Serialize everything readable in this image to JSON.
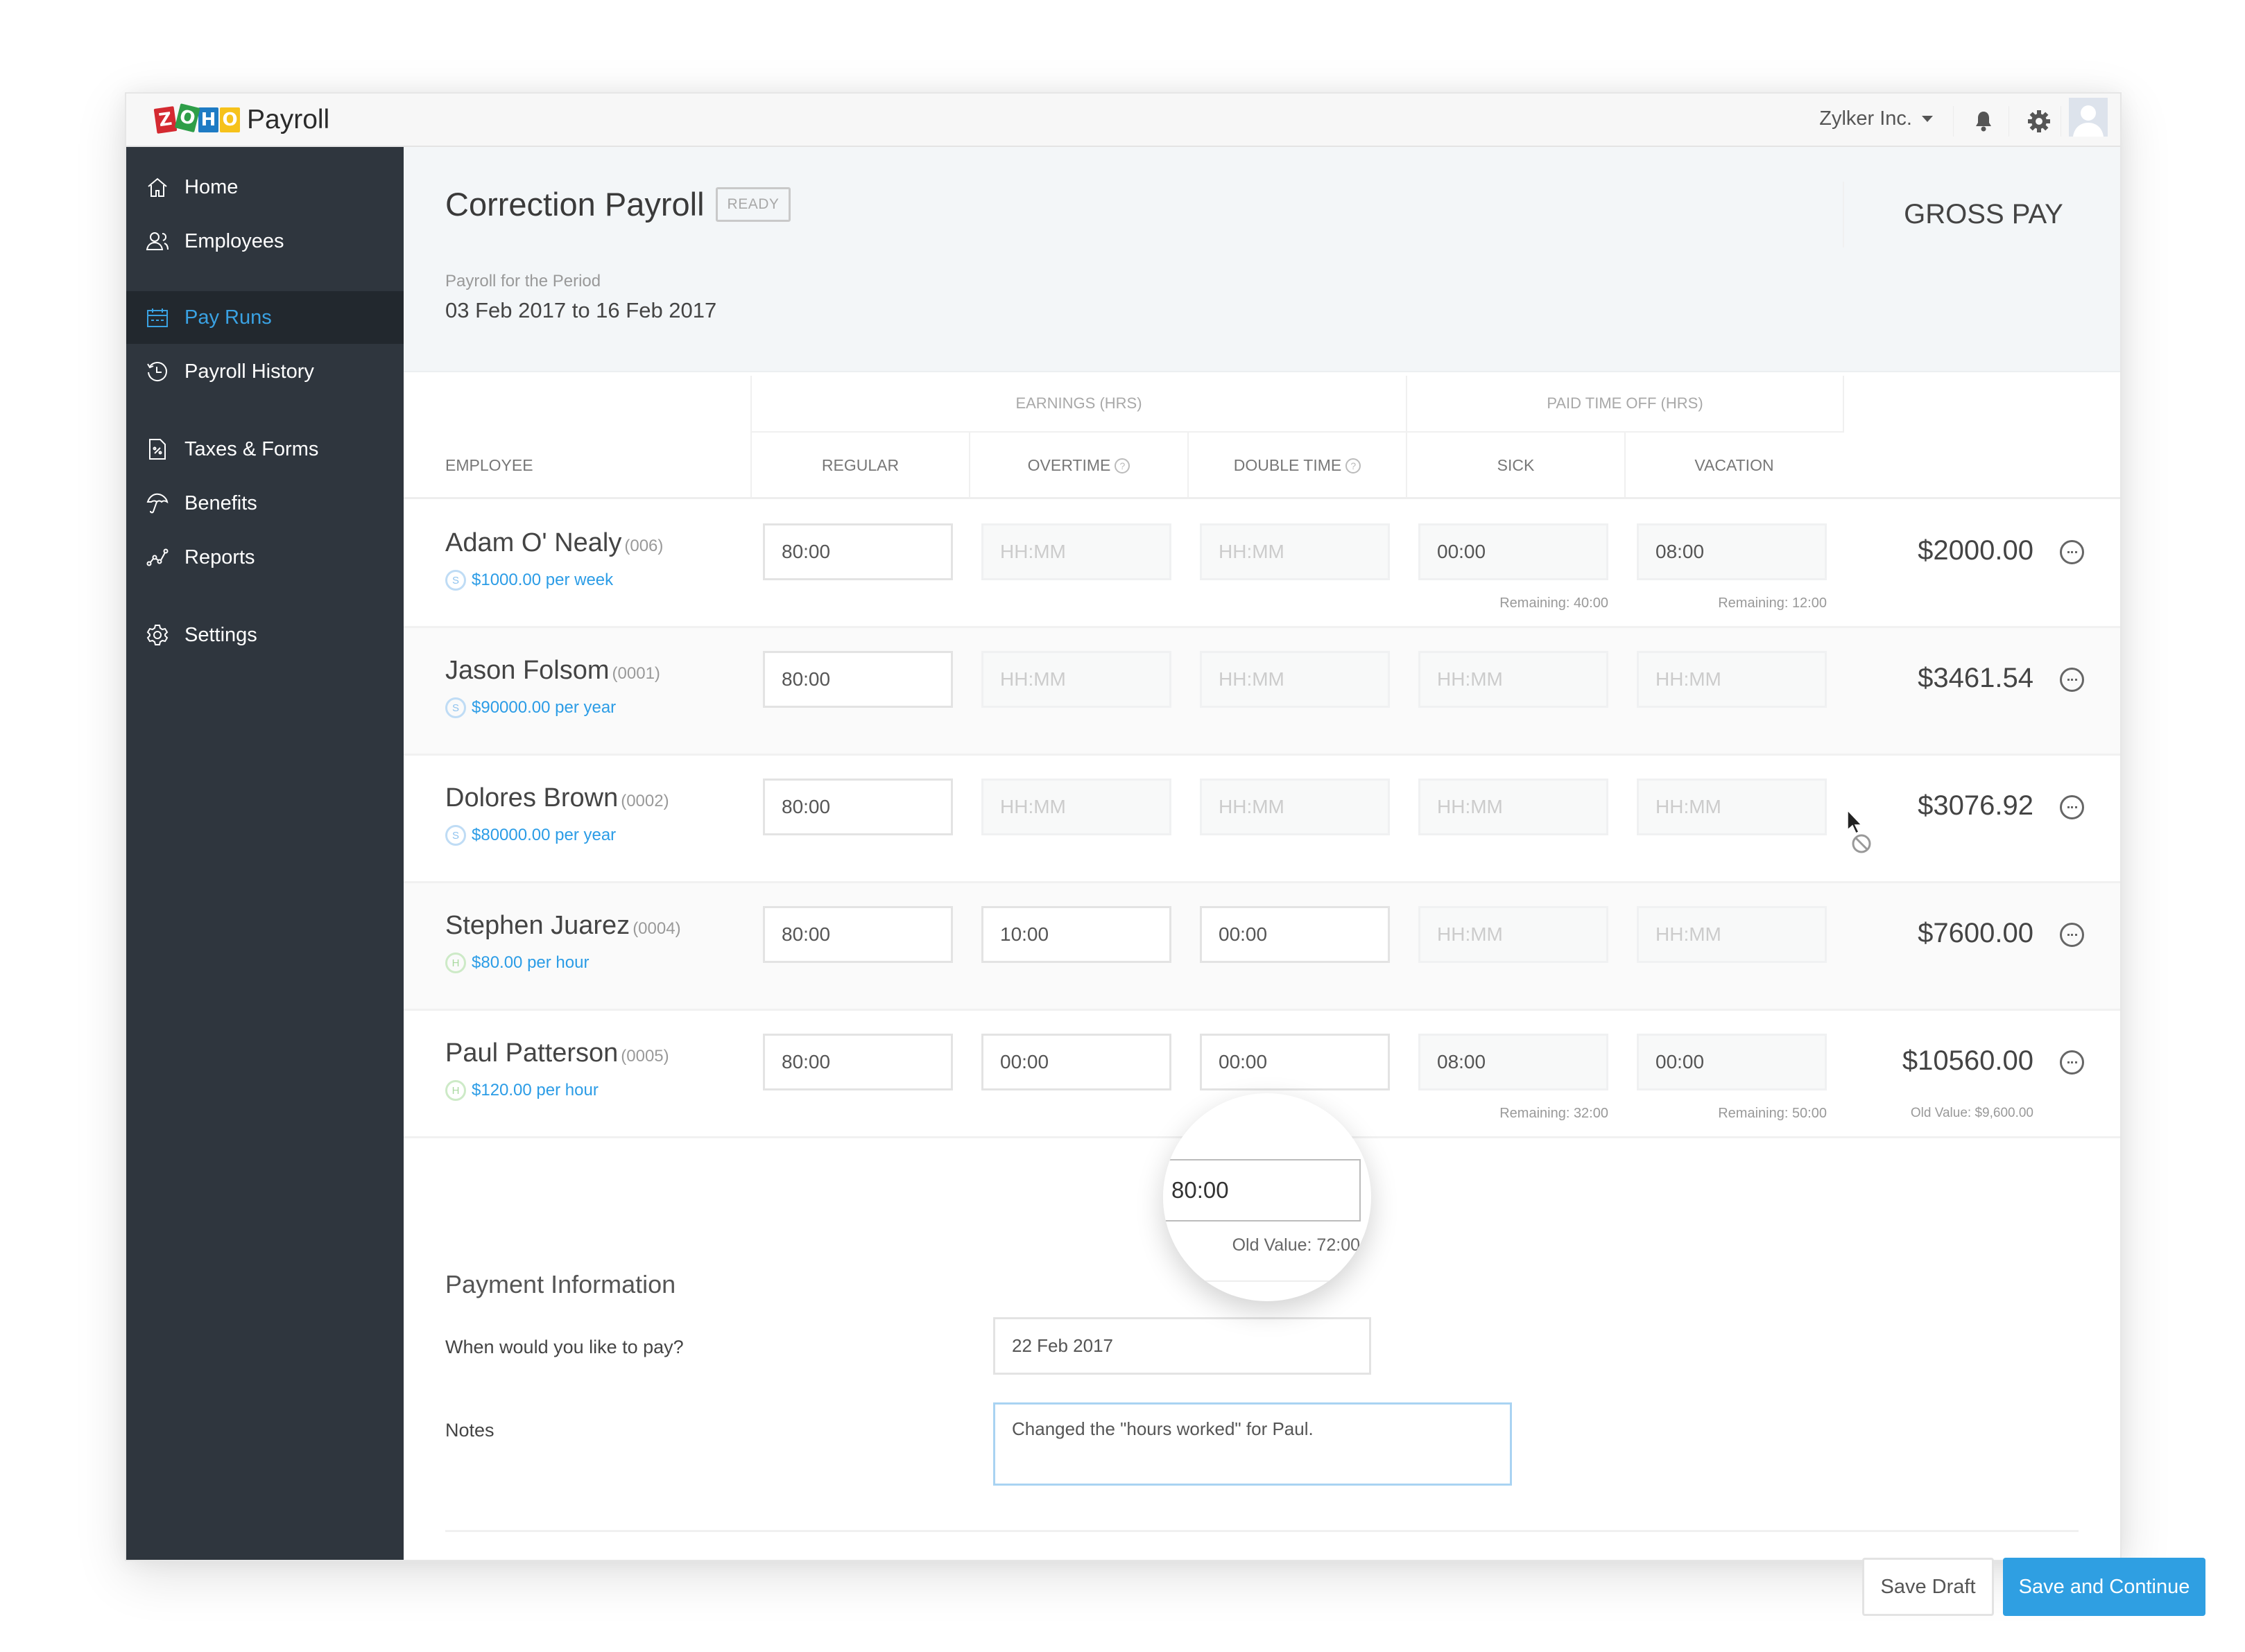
{
  "app": {
    "logo_letters": [
      "Z",
      "O",
      "H",
      "O"
    ],
    "brand": "Payroll",
    "org_name": "Zylker Inc.",
    "icons": [
      "bell-icon",
      "gear-icon",
      "avatar"
    ]
  },
  "sidebar": {
    "items": [
      {
        "label": "Home",
        "icon": "home-icon",
        "active": false
      },
      {
        "label": "Employees",
        "icon": "users-icon",
        "active": false
      },
      {
        "label": "Pay Runs",
        "icon": "calendar-icon",
        "active": true
      },
      {
        "label": "Payroll History",
        "icon": "history-icon",
        "active": false
      },
      {
        "label": "Taxes & Forms",
        "icon": "tax-form-icon",
        "active": false
      },
      {
        "label": "Benefits",
        "icon": "umbrella-icon",
        "active": false
      },
      {
        "label": "Reports",
        "icon": "line-chart-icon",
        "active": false
      },
      {
        "label": "Settings",
        "icon": "gear-icon",
        "active": false
      }
    ],
    "accent_color": "#3aa2e3"
  },
  "page": {
    "title": "Correction Payroll",
    "status_badge": "READY",
    "period_label": "Payroll for the Period",
    "period_value": "03 Feb 2017 to 16 Feb 2017"
  },
  "table": {
    "group_headers": {
      "earnings": "EARNINGS (HRS)",
      "pto": "PAID TIME OFF (HRS)"
    },
    "columns": {
      "employee": "EMPLOYEE",
      "regular": "REGULAR",
      "overtime": "OVERTIME",
      "double_time": "DOUBLE TIME",
      "sick": "SICK",
      "vacation": "VACATION",
      "gross_pay": "GROSS PAY"
    },
    "placeholder": "HH:MM",
    "rows": [
      {
        "name": "Adam O' Nealy",
        "id": "(006)",
        "rate": "$1000.00 per week",
        "rate_type": "S",
        "regular": "80:00",
        "overtime": "",
        "double_time": "",
        "sick": "00:00",
        "vacation": "08:00",
        "sick_remaining": "Remaining: 40:00",
        "vacation_remaining": "Remaining: 12:00",
        "gross_pay": "$2000.00",
        "gross_old": ""
      },
      {
        "name": "Jason Folsom",
        "id": "(0001)",
        "rate": "$90000.00 per year",
        "rate_type": "S",
        "regular": "80:00",
        "overtime": "",
        "double_time": "",
        "sick": "",
        "vacation": "",
        "sick_remaining": "",
        "vacation_remaining": "",
        "gross_pay": "$3461.54",
        "gross_old": ""
      },
      {
        "name": "Dolores Brown",
        "id": "(0002)",
        "rate": "$80000.00 per year",
        "rate_type": "S",
        "regular": "80:00",
        "overtime": "",
        "double_time": "",
        "sick": "",
        "vacation": "",
        "sick_remaining": "",
        "vacation_remaining": "",
        "gross_pay": "$3076.92",
        "gross_old": ""
      },
      {
        "name": "Stephen Juarez",
        "id": "(0004)",
        "rate": "$80.00 per hour",
        "rate_type": "H",
        "regular": "80:00",
        "overtime": "10:00",
        "double_time": "00:00",
        "sick": "",
        "vacation": "",
        "sick_remaining": "",
        "vacation_remaining": "",
        "gross_pay": "$7600.00",
        "gross_old": ""
      },
      {
        "name": "Paul Patterson",
        "id": "(0005)",
        "rate": "$120.00 per hour",
        "rate_type": "H",
        "regular": "80:00",
        "overtime": "00:00",
        "double_time": "00:00",
        "sick": "08:00",
        "vacation": "00:00",
        "sick_remaining": "Remaining: 32:00",
        "vacation_remaining": "Remaining: 50:00",
        "gross_pay": "$10560.00",
        "gross_old": "Old Value: $9,600.00"
      }
    ]
  },
  "lens": {
    "value": "80:00",
    "old_value": "Old Value: 72:00"
  },
  "payment": {
    "title": "Payment Information",
    "pay_date_label": "When would you like to pay?",
    "pay_date_value": "22 Feb 2017",
    "notes_label": "Notes",
    "notes_value": "Changed the \"hours worked\" for Paul."
  },
  "actions": {
    "save_draft": "Save Draft",
    "save_continue": "Save and Continue",
    "primary_color": "#2f9fe2"
  }
}
